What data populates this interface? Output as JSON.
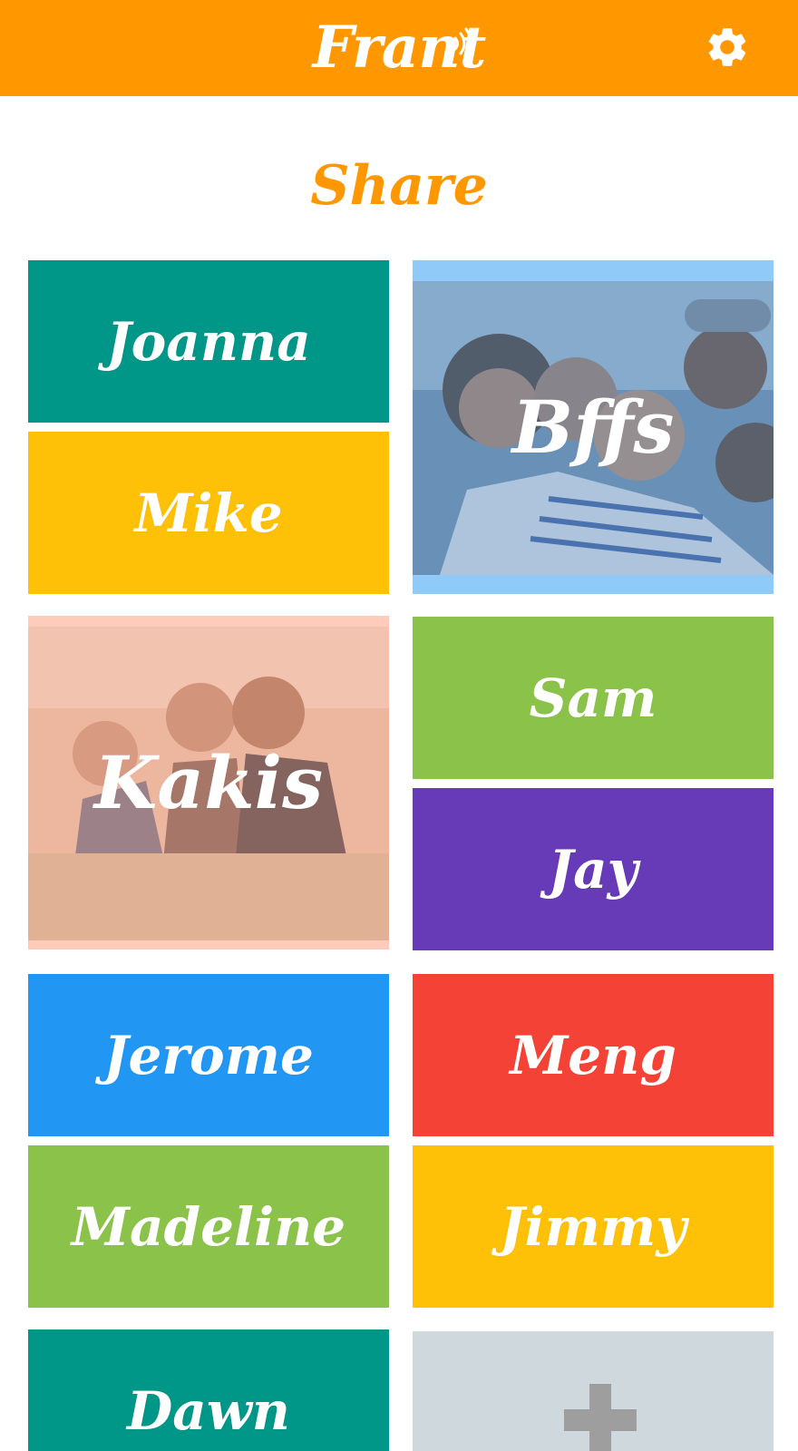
{
  "app": {
    "brand": "Frant",
    "colors": {
      "topbar": "#FF9800",
      "accent": "#FF9800"
    }
  },
  "header": {
    "settings_icon": "gear-icon"
  },
  "page": {
    "title": "Share"
  },
  "contacts": [
    {
      "name": "Joanna",
      "color": "#009688"
    },
    {
      "name": "Mike",
      "color": "#FFC107"
    },
    {
      "name": "Bffs",
      "color": "#90CAF9",
      "group": true
    },
    {
      "name": "Kakis",
      "color": "#FFAB91",
      "group": true
    },
    {
      "name": "Sam",
      "color": "#8BC34A"
    },
    {
      "name": "Jay",
      "color": "#673AB7"
    },
    {
      "name": "Jerome",
      "color": "#2196F3"
    },
    {
      "name": "Meng",
      "color": "#F44336"
    },
    {
      "name": "Madeline",
      "color": "#8BC34A"
    },
    {
      "name": "Jimmy",
      "color": "#FFC107"
    },
    {
      "name": "Dawn",
      "color": "#009688"
    }
  ],
  "add_tile": {
    "icon": "plus-icon",
    "color": "#CFD8DC"
  }
}
